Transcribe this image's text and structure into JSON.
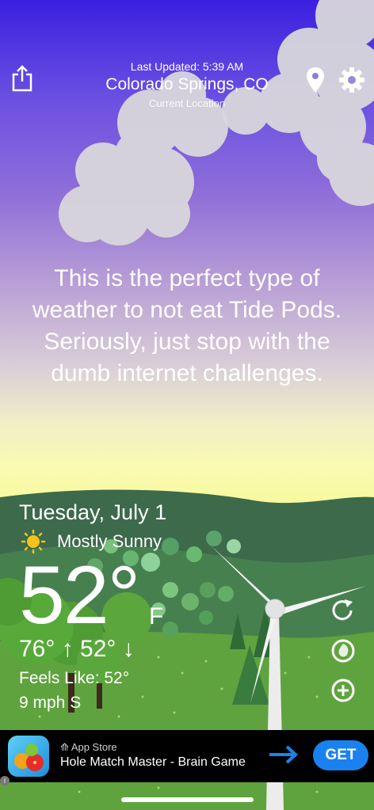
{
  "header": {
    "last_updated": "Last Updated: 5:39 AM",
    "city": "Colorado Springs, CO",
    "current_location": "Current Location"
  },
  "message": "This is the perfect type of weather to not eat Tide Pods. Seriously, just stop with the dumb internet challenges.",
  "weather": {
    "date": "Tuesday, July 1",
    "condition": "Mostly Sunny",
    "temp": "52°",
    "unit": "F",
    "hi_lo": "76° ↑  52° ↓",
    "feels_like": "Feels Like: 52°",
    "wind": "9 mph S"
  },
  "icons": {
    "share": "share-icon",
    "location": "location-pin-icon",
    "settings": "gear-icon",
    "refresh": "refresh-icon",
    "radar": "radar-icon",
    "add": "add-location-icon",
    "condition": "sun-icon"
  },
  "ad": {
    "store": "App Store",
    "title": "Hole Match Master - Brain Game",
    "cta": "GET",
    "info": "i"
  },
  "colors": {
    "sky_top": "#3a1fe0",
    "sky_bottom": "#f6f89a",
    "hills": "#3d6a4a",
    "grass": "#5fa33e",
    "cta": "#1a82f0"
  }
}
